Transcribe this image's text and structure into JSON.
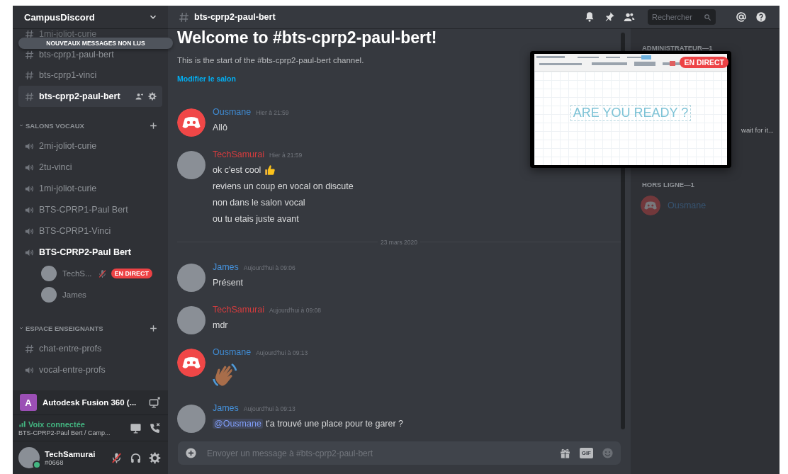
{
  "server": {
    "name": "CampusDiscord"
  },
  "unread_banner": "NOUVEAUX MESSAGES NON LUS",
  "channel_list": [
    {
      "kind": "text",
      "name": "1mi-joliot-curie",
      "selected": false,
      "connected": false
    },
    {
      "kind": "text",
      "name": "bts-cprp1-paul-bert",
      "selected": false,
      "connected": false
    },
    {
      "kind": "text",
      "name": "bts-cprp1-vinci",
      "selected": false,
      "connected": false
    },
    {
      "kind": "text",
      "name": "bts-cprp2-paul-bert",
      "selected": true,
      "connected": false
    },
    {
      "kind": "category",
      "name": "SALONS VOCAUX",
      "expanded": true
    },
    {
      "kind": "voice",
      "name": "2mi-joliot-curie",
      "selected": false,
      "connected": false
    },
    {
      "kind": "voice",
      "name": "2tu-vinci",
      "selected": false,
      "connected": false
    },
    {
      "kind": "voice",
      "name": "1mi-joliot-curie",
      "selected": false,
      "connected": false
    },
    {
      "kind": "voice",
      "name": "BTS-CPRP1-Paul Bert",
      "selected": false,
      "connected": false
    },
    {
      "kind": "voice",
      "name": "BTS-CPRP1-Vinci",
      "selected": false,
      "connected": false
    },
    {
      "kind": "voice",
      "name": "BTS-CPRP2-Paul Bert",
      "selected": false,
      "connected": true
    },
    {
      "kind": "user",
      "name": "TechS...",
      "muted": true,
      "live": "EN DIRECT"
    },
    {
      "kind": "user",
      "name": "James",
      "muted": false
    },
    {
      "kind": "category",
      "name": "ESPACE ENSEIGNANTS",
      "expanded": true
    },
    {
      "kind": "text",
      "name": "chat-entre-profs",
      "selected": false,
      "connected": false
    },
    {
      "kind": "voice",
      "name": "vocal-entre-profs",
      "selected": false,
      "connected": false
    }
  ],
  "activity": {
    "icon_letter": "A",
    "name": "Autodesk Fusion 360 (..."
  },
  "voice_panel": {
    "status": "Voix connectée",
    "location": "BTS-CPRP2-Paul Bert / Camp..."
  },
  "user_panel": {
    "name": "TechSamurai",
    "tag": "#0668",
    "online": true,
    "muted": true
  },
  "header": {
    "channel": "bts-cprp2-paul-bert",
    "search_placeholder": "Rechercher"
  },
  "intro": {
    "title": "Welcome to #bts-cprp2-paul-bert!",
    "description": "This is the start of the #bts-cprp2-paul-bert channel.",
    "link": "Modifier le salon"
  },
  "messages": [
    {
      "kind": "message",
      "author": "Ousmane",
      "color": "#3f8ad1",
      "avatar": {
        "kind": "bot"
      },
      "time": "Hier à 21:59",
      "lines": [
        {
          "text": "Allô"
        }
      ]
    },
    {
      "kind": "message",
      "author": "TechSamurai",
      "color": "#d63c3e",
      "avatar": {
        "kind": "photo"
      },
      "time": "Hier à 21:59",
      "lines": [
        {
          "text": "ok c'est cool",
          "emoji": {
            "kind": "thumbs_up"
          }
        },
        {
          "text": "reviens un coup en vocal on discute"
        },
        {
          "text": "non dans le salon vocal"
        },
        {
          "text": "ou tu etais juste avant"
        }
      ]
    },
    {
      "kind": "divider",
      "text": "23 mars 2020"
    },
    {
      "kind": "message",
      "author": "James",
      "color": "#4592dc",
      "avatar": {
        "kind": "photo"
      },
      "time": "Aujourd'hui à 09:06",
      "lines": [
        {
          "text": "Présent"
        }
      ]
    },
    {
      "kind": "message",
      "author": "TechSamurai",
      "color": "#d63c3e",
      "avatar": {
        "kind": "photo"
      },
      "time": "Aujourd'hui à 09:08",
      "lines": [
        {
          "text": "mdr"
        }
      ]
    },
    {
      "kind": "message",
      "author": "Ousmane",
      "color": "#3f8ad1",
      "avatar": {
        "kind": "bot"
      },
      "time": "Aujourd'hui à 09:13",
      "lines": [
        {
          "emoji": {
            "kind": "waving_hand"
          }
        }
      ]
    },
    {
      "kind": "message",
      "author": "James",
      "color": "#4592dc",
      "avatar": {
        "kind": "photo"
      },
      "time": "Aujourd'hui à 09:13",
      "lines": [
        {
          "mention": "@Ousmane",
          "text": "t'a trouvé une place pour te garer ?"
        }
      ]
    }
  ],
  "composer": {
    "placeholder": "Envoyer un message à #bts-cprp2-paul-bert",
    "gif_label": "GIF"
  },
  "member_groups": [
    {
      "title": "ADMINISTRATEUR—1",
      "members": [
        {
          "status_text": "wait for it...",
          "offline": false
        }
      ]
    },
    {
      "title": "HORS LIGNE—1",
      "members": [
        {
          "name": "Ousmane",
          "avatar": {
            "kind": "bot"
          },
          "offline": true
        }
      ]
    }
  ],
  "stream": {
    "badge": "EN DIRECT",
    "content_text": "ARE YOU READY ?"
  }
}
